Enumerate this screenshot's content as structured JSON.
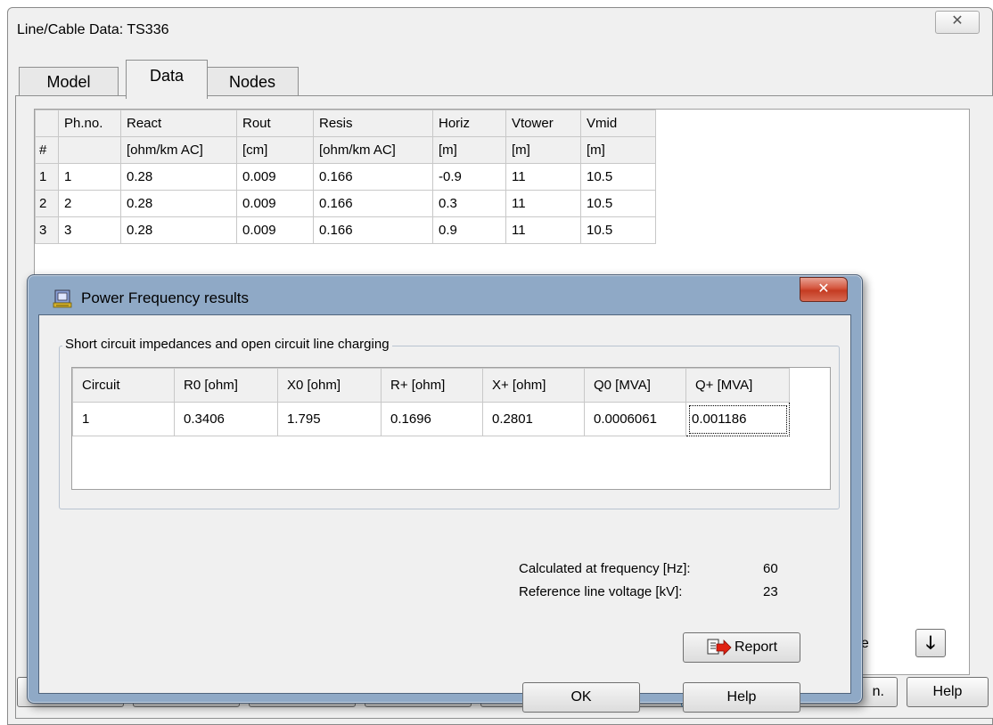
{
  "window": {
    "title": "Line/Cable Data: TS336",
    "close_glyph": "✕"
  },
  "tabs": [
    {
      "label": "Model"
    },
    {
      "label": "Data"
    },
    {
      "label": "Nodes"
    }
  ],
  "data_grid": {
    "header_names": [
      "",
      "Ph.no.",
      "React",
      "Rout",
      "Resis",
      "Horiz",
      "Vtower",
      "Vmid"
    ],
    "header_units": [
      "#",
      "",
      "[ohm/km AC]",
      "[cm]",
      "[ohm/km AC]",
      "[m]",
      "[m]",
      "[m]"
    ],
    "rows": [
      [
        "1",
        "1",
        "0.28",
        "0.009",
        "0.166",
        "-0.9",
        "11",
        "10.5"
      ],
      [
        "2",
        "2",
        "0.28",
        "0.009",
        "0.166",
        "0.3",
        "11",
        "10.5"
      ],
      [
        "3",
        "3",
        "0.28",
        "0.009",
        "0.166",
        "0.9",
        "11",
        "10.5"
      ]
    ]
  },
  "move_controls": {
    "label": "ove",
    "down_glyph": "🡓"
  },
  "bottom_buttons": {
    "partial_label": "n.",
    "help_label": "Help"
  },
  "dialog": {
    "title": "Power Frequency results",
    "close_glyph": "✕",
    "group_title": "Short circuit impedances and open circuit line charging",
    "table": {
      "headers": [
        "Circuit",
        "R0 [ohm]",
        "X0 [ohm]",
        "R+ [ohm]",
        "X+ [ohm]",
        "Q0 [MVA]",
        "Q+ [MVA]"
      ],
      "rows": [
        [
          "1",
          "0.3406",
          "1.795",
          "0.1696",
          "0.2801",
          "0.0006061",
          "0.001186"
        ]
      ]
    },
    "frequency_label": "Calculated at frequency [Hz]:",
    "frequency_value": "60",
    "voltage_label": "Reference line voltage [kV]:",
    "voltage_value": "23",
    "report_label": "Report",
    "ok_label": "OK",
    "help_label": "Help"
  },
  "colors": {
    "dialog_frame": "#8fa9c6",
    "close_button_red": "#c43b22",
    "client_bg": "#f0f0f0"
  }
}
